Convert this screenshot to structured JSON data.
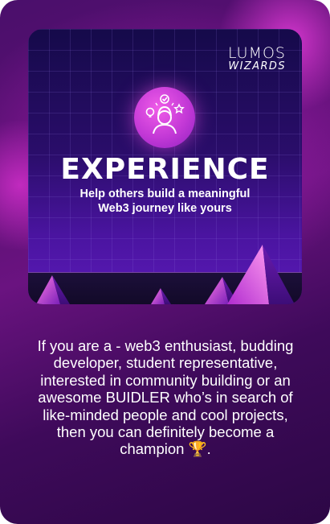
{
  "logo": {
    "line1": "LUMOS",
    "line2": "WIZARDS"
  },
  "hero": {
    "badge_icon": "person-ideas-icon",
    "title": "EXPERIENCE",
    "subtitle_line1": "Help others build a meaningful",
    "subtitle_line2": "Web3 journey like yours"
  },
  "description": {
    "text": "If you are a - web3 enthusiast, budding developer, student representative, interested in community building or an awesome BUIDLER who’s in search of like-minded people and cool projects, then you can definitely become a champion 🏆."
  },
  "colors": {
    "accent": "#d33ad6",
    "card_bg": "#4a0f6b",
    "hero_bg": "#2a0d6a"
  }
}
